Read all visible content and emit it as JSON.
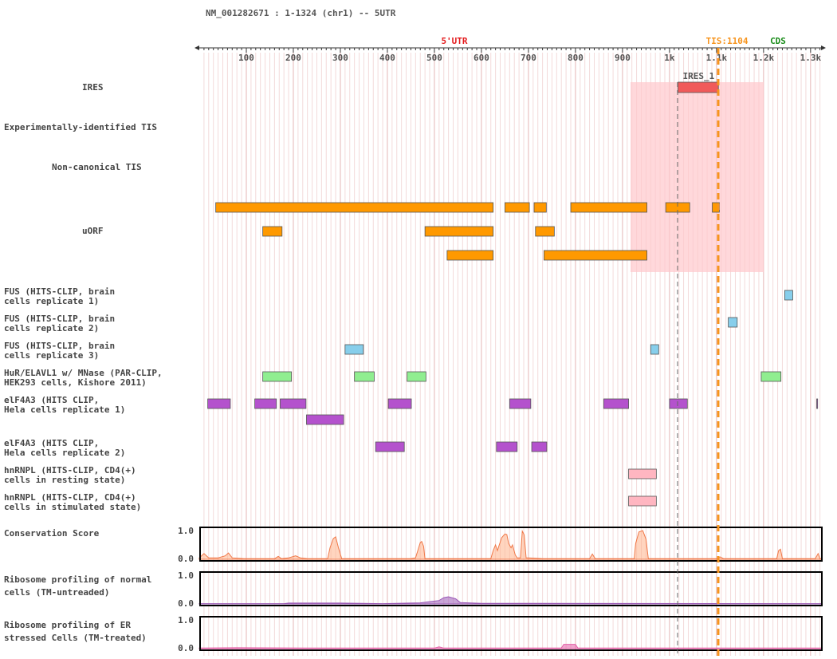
{
  "header": {
    "title": "NM_001282671 : 1-1324 (chr1) -- 5UTR",
    "region_5utr": "5'UTR",
    "tis_label": "TIS:1104",
    "cds_label": "CDS",
    "ires_feature_label": "IRES_1"
  },
  "ruler": {
    "length": 1324,
    "tis": 1104,
    "ticks": [
      {
        "pos": 100,
        "label": "100"
      },
      {
        "pos": 200,
        "label": "200"
      },
      {
        "pos": 300,
        "label": "300"
      },
      {
        "pos": 400,
        "label": "400"
      },
      {
        "pos": 500,
        "label": "500"
      },
      {
        "pos": 600,
        "label": "600"
      },
      {
        "pos": 700,
        "label": "700"
      },
      {
        "pos": 800,
        "label": "800"
      },
      {
        "pos": 900,
        "label": "900"
      },
      {
        "pos": 1000,
        "label": "1k"
      },
      {
        "pos": 1100,
        "label": "1.1k"
      },
      {
        "pos": 1200,
        "label": "1.2k"
      },
      {
        "pos": 1300,
        "label": "1.3k"
      }
    ]
  },
  "colors": {
    "utr_label": "#e31a1c",
    "tis": "#f7941d",
    "cds_label": "#1a8c1a",
    "ires_fill": "#f05a5a",
    "ires_region": "#ffc8cc",
    "uorf": "#ff9900",
    "fus": "#87ceeb",
    "hur": "#90ee90",
    "eif4a3": "#b452cd",
    "hnrnpl": "#ffb6c1",
    "conservation": "#ffb38a",
    "conservation_line": "#f07848",
    "ribo": "#9b59b6",
    "ribo_er": "#e35fa6"
  },
  "track_labels": {
    "ires": "IRES",
    "exp_tis": "Experimentally-identified TIS",
    "noncanon_tis": "Non-canonical TIS",
    "uorf": "uORF",
    "fus1": "FUS (HITS-CLIP, brain\ncells replicate 1)",
    "fus2": "FUS (HITS-CLIP, brain\ncells replicate 2)",
    "fus3": "FUS (HITS-CLIP, brain\ncells replicate 3)",
    "hur": "HuR/ELAVL1 w/ MNase (PAR-CLIP,\nHEK293 cells, Kishore 2011)",
    "eif4a3_1": "elF4A3 (HITS CLIP,\nHela cells replicate 1)",
    "eif4a3_2": "elF4A3 (HITS CLIP,\nHela cells replicate 2)",
    "hnrnpl_rest": "hnRNPL (HITS-CLIP, CD4(+)\ncells in resting state)",
    "hnrnpl_stim": "hnRNPL (HITS-CLIP, CD4(+)\ncells in stimulated state)",
    "conservation": "Conservation Score",
    "ribo_normal": "Ribosome profiling of normal\ncells (TM-untreaded)",
    "ribo_er": "Ribosome profiling of ER\nstressed Cells (TM-treated)"
  },
  "axis_labels": {
    "max": "1.0",
    "min": "0.0"
  },
  "features": {
    "ires": [
      {
        "start": 1018,
        "end": 1104
      }
    ],
    "uorf": [
      {
        "start": 35,
        "end": 625,
        "row": 0
      },
      {
        "start": 650,
        "end": 702,
        "row": 0
      },
      {
        "start": 712,
        "end": 738,
        "row": 0
      },
      {
        "start": 790,
        "end": 952,
        "row": 0
      },
      {
        "start": 992,
        "end": 1043,
        "row": 0
      },
      {
        "start": 1091,
        "end": 1106,
        "row": 0
      },
      {
        "start": 135,
        "end": 176,
        "row": 1
      },
      {
        "start": 480,
        "end": 625,
        "row": 1
      },
      {
        "start": 715,
        "end": 755,
        "row": 1
      },
      {
        "start": 527,
        "end": 625,
        "row": 2
      },
      {
        "start": 733,
        "end": 952,
        "row": 2
      }
    ],
    "fus1": [
      {
        "start": 1245,
        "end": 1262
      }
    ],
    "fus2": [
      {
        "start": 1125,
        "end": 1144
      }
    ],
    "fus3": [
      {
        "start": 310,
        "end": 349
      },
      {
        "start": 960,
        "end": 977
      }
    ],
    "hur": [
      {
        "start": 135,
        "end": 196
      },
      {
        "start": 330,
        "end": 372
      },
      {
        "start": 442,
        "end": 482
      },
      {
        "start": 1195,
        "end": 1237
      }
    ],
    "eif4a3_1": [
      {
        "start": 18,
        "end": 66,
        "row": 0
      },
      {
        "start": 118,
        "end": 164,
        "row": 0
      },
      {
        "start": 172,
        "end": 227,
        "row": 0
      },
      {
        "start": 402,
        "end": 451,
        "row": 0
      },
      {
        "start": 660,
        "end": 705,
        "row": 0
      },
      {
        "start": 860,
        "end": 913,
        "row": 0
      },
      {
        "start": 1000,
        "end": 1038,
        "row": 0
      },
      {
        "start": 1313,
        "end": 1315,
        "row": 0
      },
      {
        "start": 228,
        "end": 307,
        "row": 1
      }
    ],
    "eif4a3_2": [
      {
        "start": 375,
        "end": 436
      },
      {
        "start": 632,
        "end": 676
      },
      {
        "start": 707,
        "end": 739
      }
    ],
    "hnrnpl_rest": [
      {
        "start": 913,
        "end": 972
      }
    ],
    "hnrnpl_stim": [
      {
        "start": 913,
        "end": 972
      }
    ]
  },
  "signals": {
    "conservation": [
      [
        0,
        0.05
      ],
      [
        10,
        0.2
      ],
      [
        20,
        0.05
      ],
      [
        40,
        0.05
      ],
      [
        55,
        0.12
      ],
      [
        62,
        0.22
      ],
      [
        70,
        0.05
      ],
      [
        95,
        0.02
      ],
      [
        160,
        0.02
      ],
      [
        168,
        0.1
      ],
      [
        175,
        0.02
      ],
      [
        190,
        0.05
      ],
      [
        205,
        0.12
      ],
      [
        215,
        0.05
      ],
      [
        230,
        0.02
      ],
      [
        273,
        0.02
      ],
      [
        278,
        0.4
      ],
      [
        285,
        0.72
      ],
      [
        290,
        0.78
      ],
      [
        296,
        0.4
      ],
      [
        303,
        0.02
      ],
      [
        350,
        0.02
      ],
      [
        450,
        0.02
      ],
      [
        460,
        0.05
      ],
      [
        465,
        0.32
      ],
      [
        470,
        0.58
      ],
      [
        473,
        0.62
      ],
      [
        477,
        0.45
      ],
      [
        480,
        0.02
      ],
      [
        620,
        0.02
      ],
      [
        625,
        0.3
      ],
      [
        630,
        0.5
      ],
      [
        634,
        0.3
      ],
      [
        638,
        0.5
      ],
      [
        643,
        0.75
      ],
      [
        650,
        0.88
      ],
      [
        654,
        0.86
      ],
      [
        658,
        0.55
      ],
      [
        663,
        0.4
      ],
      [
        666,
        0.5
      ],
      [
        672,
        0.15
      ],
      [
        676,
        0.05
      ],
      [
        683,
        0.05
      ],
      [
        687,
        0.98
      ],
      [
        691,
        0.85
      ],
      [
        695,
        0.05
      ],
      [
        700,
        0.05
      ],
      [
        730,
        0.02
      ],
      [
        830,
        0.02
      ],
      [
        836,
        0.18
      ],
      [
        842,
        0.02
      ],
      [
        880,
        0.02
      ],
      [
        925,
        0.02
      ],
      [
        928,
        0.55
      ],
      [
        935,
        0.95
      ],
      [
        943,
        1.0
      ],
      [
        950,
        0.7
      ],
      [
        955,
        0.02
      ],
      [
        1100,
        0.02
      ],
      [
        1108,
        0.08
      ],
      [
        1115,
        0.02
      ],
      [
        1228,
        0.02
      ],
      [
        1232,
        0.3
      ],
      [
        1236,
        0.35
      ],
      [
        1240,
        0.02
      ],
      [
        1310,
        0.02
      ],
      [
        1316,
        0.2
      ],
      [
        1320,
        0.02
      ],
      [
        1324,
        0.02
      ]
    ],
    "ribo_normal": [
      [
        0,
        0.01
      ],
      [
        180,
        0.01
      ],
      [
        190,
        0.03
      ],
      [
        300,
        0.03
      ],
      [
        390,
        0.01
      ],
      [
        470,
        0.04
      ],
      [
        490,
        0.08
      ],
      [
        510,
        0.12
      ],
      [
        520,
        0.22
      ],
      [
        530,
        0.25
      ],
      [
        545,
        0.18
      ],
      [
        555,
        0.05
      ],
      [
        600,
        0.02
      ],
      [
        700,
        0.02
      ],
      [
        1324,
        0.01
      ]
    ],
    "ribo_er": [
      [
        0,
        0.02
      ],
      [
        80,
        0.03
      ],
      [
        250,
        0.02
      ],
      [
        500,
        0.02
      ],
      [
        510,
        0.06
      ],
      [
        520,
        0.02
      ],
      [
        770,
        0.02
      ],
      [
        775,
        0.15
      ],
      [
        800,
        0.15
      ],
      [
        805,
        0.02
      ],
      [
        1324,
        0.02
      ]
    ]
  }
}
